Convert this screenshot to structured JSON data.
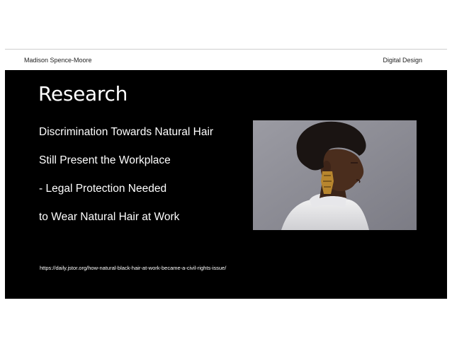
{
  "header": {
    "author": "Madison Spence-Moore",
    "course": "Digital Design"
  },
  "slide": {
    "title": "Research",
    "lines": [
      "Discrimination Towards Natural Hair",
      "Still Present the Workplace",
      "- Legal Protection Needed",
      "to Wear Natural Hair at Work"
    ],
    "source_url": "https://daily.jstor.org/how-natural-black-hair-at-work-became-a-civil-rights-issue/"
  },
  "colors": {
    "slide_background": "#000000",
    "text": "#ffffff",
    "photo_background": "#8a8a93"
  },
  "photo": {
    "icon": "portrait-photo"
  }
}
